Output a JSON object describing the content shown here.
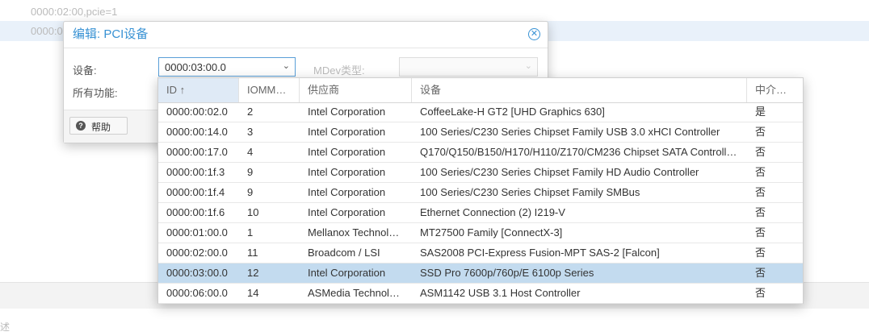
{
  "background": {
    "rows": [
      "0000:02:00,pcie=1",
      "0000:0"
    ],
    "bottom_text": "述"
  },
  "dialog": {
    "title": "编辑: PCI设备",
    "device_label": "设备:",
    "device_value": "0000:03:00.0",
    "all_functions_label": "所有功能:",
    "mdev_label": "MDev类型:",
    "help_label": "帮助"
  },
  "grid": {
    "columns": [
      "ID ↑",
      "IOMM…",
      "供应商",
      "设备",
      "中介…"
    ],
    "rows": [
      {
        "id": "0000:00:02.0",
        "iommu": "2",
        "vendor": "Intel Corporation",
        "device": "CoffeeLake-H GT2 [UHD Graphics 630]",
        "mdev": "是"
      },
      {
        "id": "0000:00:14.0",
        "iommu": "3",
        "vendor": "Intel Corporation",
        "device": "100 Series/C230 Series Chipset Family USB 3.0 xHCI Controller",
        "mdev": "否"
      },
      {
        "id": "0000:00:17.0",
        "iommu": "4",
        "vendor": "Intel Corporation",
        "device": "Q170/Q150/B150/H170/H110/Z170/CM236 Chipset SATA Controll…",
        "mdev": "否"
      },
      {
        "id": "0000:00:1f.3",
        "iommu": "9",
        "vendor": "Intel Corporation",
        "device": "100 Series/C230 Series Chipset Family HD Audio Controller",
        "mdev": "否"
      },
      {
        "id": "0000:00:1f.4",
        "iommu": "9",
        "vendor": "Intel Corporation",
        "device": "100 Series/C230 Series Chipset Family SMBus",
        "mdev": "否"
      },
      {
        "id": "0000:00:1f.6",
        "iommu": "10",
        "vendor": "Intel Corporation",
        "device": "Ethernet Connection (2) I219-V",
        "mdev": "否"
      },
      {
        "id": "0000:01:00.0",
        "iommu": "1",
        "vendor": "Mellanox Technol…",
        "device": "MT27500 Family [ConnectX-3]",
        "mdev": "否"
      },
      {
        "id": "0000:02:00.0",
        "iommu": "11",
        "vendor": "Broadcom / LSI",
        "device": "SAS2008 PCI-Express Fusion-MPT SAS-2 [Falcon]",
        "mdev": "否"
      },
      {
        "id": "0000:03:00.0",
        "iommu": "12",
        "vendor": "Intel Corporation",
        "device": "SSD Pro 7600p/760p/E 6100p Series",
        "mdev": "否",
        "selected": true
      },
      {
        "id": "0000:06:00.0",
        "iommu": "14",
        "vendor": "ASMedia Technol…",
        "device": "ASM1142 USB 3.1 Host Controller",
        "mdev": "否"
      }
    ]
  },
  "colors": {
    "accent": "#3892d4",
    "selected_row": "#c3dbef"
  }
}
